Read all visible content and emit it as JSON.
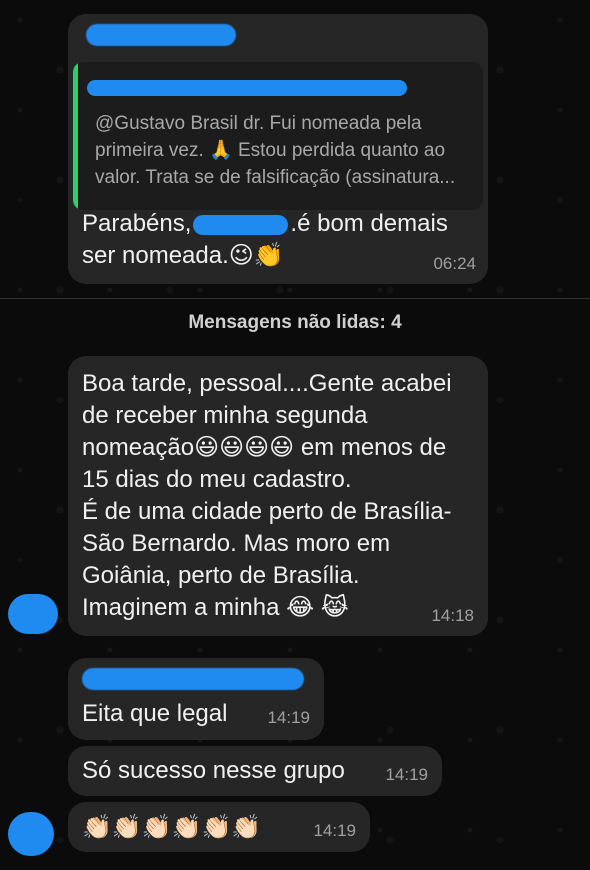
{
  "conversation": {
    "reply_message": {
      "quote_text": "@Gustavo Brasil dr. Fui nomeada pela primeira vez. 🙏 Estou perdida quanto ao valor. Trata se de falsificação (assinatura...",
      "text_before": "Parabéns,",
      "text_after": ".é  bom demais ser nomeada.😉👏",
      "time": "06:24"
    },
    "unread_label": "Mensagens não lidas: 4",
    "messages": [
      {
        "text": "Boa tarde, pessoal....Gente acabei de receber minha segunda nomeação😃😃😃😃 em menos de 15 dias do meu cadastro.\nÉ de uma cidade perto de Brasília- São Bernardo. Mas moro em Goiânia, perto de Brasília.\nImaginem a minha 😂 😹",
        "time": "14:18"
      },
      {
        "text": "Eita que legal",
        "time": "14:19"
      },
      {
        "text": "Só sucesso nesse grupo",
        "time": "14:19"
      },
      {
        "text": "👏🏻👏🏻👏🏻👏🏻👏🏻👏🏻",
        "time": "14:19"
      }
    ]
  }
}
